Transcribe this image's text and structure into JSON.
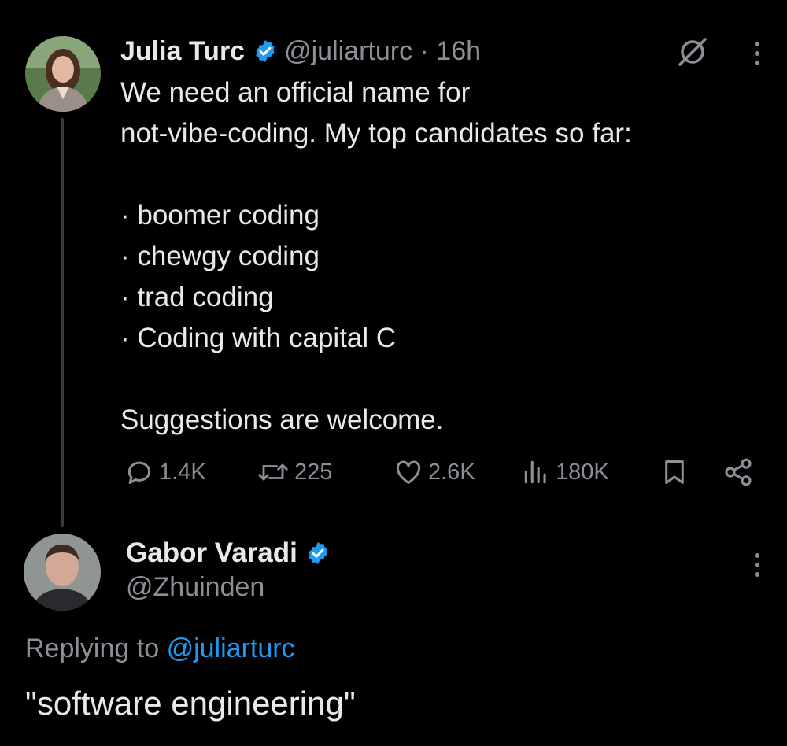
{
  "colors": {
    "background": "#000000",
    "text_primary": "#e7e9ea",
    "text_secondary": "#8b9097",
    "accent": "#1d9bf0",
    "thread_line": "#3a3d40"
  },
  "tweet": {
    "author": {
      "display_name": "Julia Turc",
      "handle_time": "@juliarturc · 16h",
      "avatar_icon": "profile-photo-woman",
      "verified_icon": "verified-badge-icon"
    },
    "text_lines": [
      "We need an official name for",
      "not-vibe-coding. My top candidates so far:",
      "",
      "· boomer coding",
      "· chewgy coding",
      "· trad coding",
      "· Coding with capital C",
      "",
      "Suggestions are welcome."
    ],
    "actions": {
      "replies": "1.4K",
      "retweets": "225",
      "likes": "2.6K",
      "views": "180K"
    },
    "icons": [
      "grok-icon",
      "more-options-icon",
      "reply-icon",
      "retweet-icon",
      "like-icon",
      "views-icon",
      "bookmark-icon",
      "share-icon"
    ]
  },
  "reply": {
    "author": {
      "display_name": "Gabor Varadi",
      "handle": "@Zhuinden",
      "avatar_icon": "profile-photo-man"
    },
    "replying_prefix": "Replying to",
    "replying_mention": "@juliarturc",
    "text": "\"software engineering\""
  }
}
